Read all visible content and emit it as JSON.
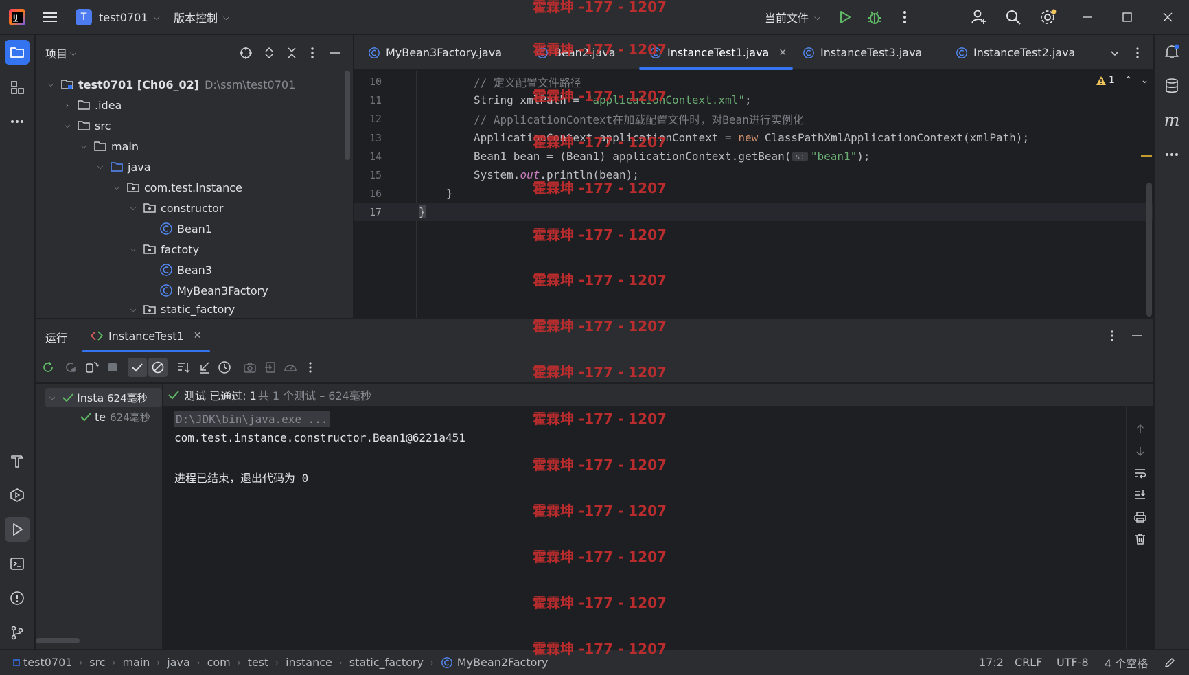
{
  "titlebar": {
    "project_badge": "T",
    "project_name": "test0701",
    "vcs_label": "版本控制",
    "run_config": "当前文件"
  },
  "project_panel": {
    "title": "项目",
    "tree": [
      {
        "label": "test0701 [Ch06_02]",
        "detail": "D:\\ssm\\test0701",
        "icon": "module-folder-icon"
      },
      {
        "label": ".idea",
        "icon": "folder-icon"
      },
      {
        "label": "src",
        "icon": "folder-icon"
      },
      {
        "label": "main",
        "icon": "folder-icon"
      },
      {
        "label": "java",
        "icon": "source-folder-icon"
      },
      {
        "label": "com.test.instance",
        "icon": "package-icon"
      },
      {
        "label": "constructor",
        "icon": "package-icon"
      },
      {
        "label": "Bean1",
        "icon": "class-icon"
      },
      {
        "label": "factoty",
        "icon": "package-icon"
      },
      {
        "label": "Bean3",
        "icon": "class-icon"
      },
      {
        "label": "MyBean3Factory",
        "icon": "class-icon"
      },
      {
        "label": "static_factory",
        "icon": "package-icon"
      }
    ]
  },
  "editor": {
    "tabs": [
      {
        "label": "MyBean3Factory.java"
      },
      {
        "label": "Bean2.java"
      },
      {
        "label": "InstanceTest1.java",
        "active": true
      },
      {
        "label": "InstanceTest3.java"
      },
      {
        "label": "InstanceTest2.java"
      }
    ],
    "warnings_count": "1",
    "lines": [
      {
        "num": "10",
        "comment": "// 定义配置文件路径"
      },
      {
        "num": "11",
        "a": "String xmlPath = ",
        "str": "\"applicationContext.xml\"",
        "b": ";"
      },
      {
        "num": "12",
        "comment": "// ApplicationContext在加载配置文件时，对Bean进行实例化"
      },
      {
        "num": "13",
        "a": "ApplicationContext applicationContext = ",
        "kw": "new",
        "b": " ClassPathXmlApplicationContext(xmlPath);"
      },
      {
        "num": "14",
        "a": "Bean1 bean = (Bean1) applicationContext.getBean(",
        "hint": "s:",
        "str": "\"bean1\"",
        "b": ");"
      },
      {
        "num": "15",
        "a": "System.",
        "field": "out",
        "b": ".println(bean);"
      },
      {
        "num": "16",
        "a": "}"
      },
      {
        "num": "17",
        "a": "}"
      }
    ]
  },
  "run_panel": {
    "title": "运行",
    "config_tab": "InstanceTest1",
    "status_passed": "测试 已通过: 1",
    "status_detail": "共 1 个测试 – 624毫秒",
    "tests": [
      {
        "name": "Insta",
        "time": "624毫秒"
      },
      {
        "name": "te",
        "time": "624毫秒"
      }
    ],
    "console": [
      "D:\\JDK\\bin\\java.exe ...",
      "com.test.instance.constructor.Bean1@6221a451",
      "",
      "进程已结束，退出代码为 0"
    ]
  },
  "statusbar": {
    "breadcrumb": [
      "test0701",
      "src",
      "main",
      "java",
      "com",
      "test",
      "instance",
      "static_factory",
      "MyBean2Factory"
    ],
    "position": "17:2",
    "line_sep": "CRLF",
    "encoding": "UTF-8",
    "indent": "4 个空格"
  },
  "watermark": "霍霖坤 -177 - 1207"
}
